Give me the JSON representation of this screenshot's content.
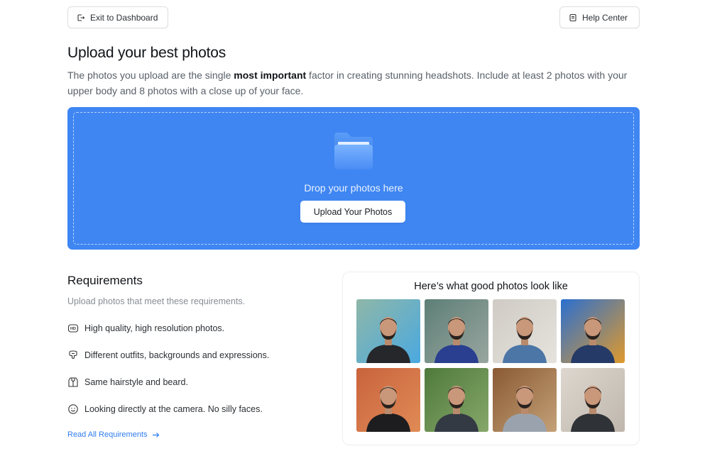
{
  "header": {
    "exit_label": "Exit to Dashboard",
    "help_label": "Help Center"
  },
  "page": {
    "title": "Upload your best photos",
    "desc_before": "The photos you upload are the single ",
    "desc_bold": "most important",
    "desc_after": " factor in creating stunning headshots. Include at least 2 photos with your upper body and 8 photos with a close up of your face."
  },
  "dropzone": {
    "text": "Drop your photos here",
    "button_label": "Upload Your Photos",
    "color": "#3f86f2"
  },
  "requirements": {
    "title": "Requirements",
    "subtitle": "Upload photos that meet these requirements.",
    "items": [
      {
        "icon": "hd-icon",
        "label": "High quality, high resolution photos."
      },
      {
        "icon": "shirt-icon",
        "label": "Different outfits, backgrounds and expressions."
      },
      {
        "icon": "hair-icon",
        "label": "Same hairstyle and beard."
      },
      {
        "icon": "smile-icon",
        "label": "Looking directly at the camera. No silly faces."
      }
    ],
    "link_label": "Read All Requirements"
  },
  "gallery": {
    "title": "Here’s what good photos look like",
    "photos": [
      {
        "bg": "#8fb7a8",
        "bg2": "#4aa9e0",
        "shirt": "#25272b"
      },
      {
        "bg": "#5d7f76",
        "bg2": "#99a6a0",
        "shirt": "#2a3f8f"
      },
      {
        "bg": "#cfcbc4",
        "bg2": "#e6e3de",
        "shirt": "#4b76a6"
      },
      {
        "bg": "#2a6fd0",
        "bg2": "#e09a2c",
        "shirt": "#253a66"
      },
      {
        "bg": "#c9633d",
        "bg2": "#e08b56",
        "shirt": "#1d1d1f"
      },
      {
        "bg": "#4f7a3c",
        "bg2": "#86a86a",
        "shirt": "#343a44"
      },
      {
        "bg": "#8a5a34",
        "bg2": "#c4a178",
        "shirt": "#9aa3ad"
      },
      {
        "bg": "#ddd7cf",
        "bg2": "#bfb7ad",
        "shirt": "#2f3236"
      }
    ]
  }
}
